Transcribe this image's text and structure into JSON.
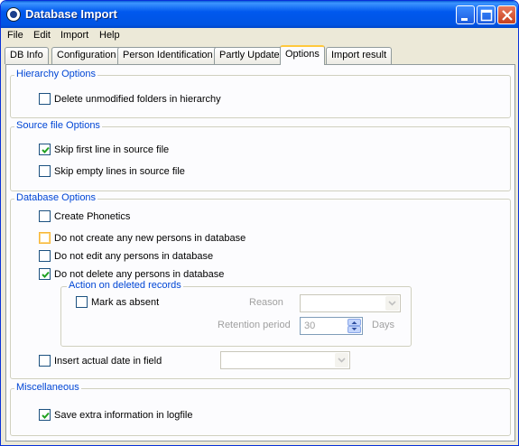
{
  "window": {
    "title": "Database Import"
  },
  "menu": [
    "File",
    "Edit",
    "Import",
    "Help"
  ],
  "tabs": [
    "DB Info",
    "Configuration",
    "Person Identification",
    "Partly Update",
    "Options",
    "Import result"
  ],
  "active_tab": "Options",
  "hierarchy": {
    "title": "Hierarchy Options",
    "delete_unmodified": {
      "label": "Delete unmodified folders in hierarchy",
      "checked": false
    }
  },
  "source": {
    "title": "Source file Options",
    "skip_first": {
      "label": "Skip first line in source file",
      "checked": true
    },
    "skip_empty": {
      "label": "Skip empty lines in source file",
      "checked": false
    }
  },
  "database": {
    "title": "Database Options",
    "create_phonetics": {
      "label": "Create Phonetics",
      "checked": false
    },
    "no_create": {
      "label": "Do not create any new persons in database",
      "checked": false
    },
    "no_edit": {
      "label": "Do not edit any persons in database",
      "checked": false
    },
    "no_delete": {
      "label": "Do not delete any persons in database",
      "checked": true
    },
    "action": {
      "title": "Action on deleted records",
      "mark_absent": {
        "label": "Mark as absent",
        "checked": false
      },
      "reason_label": "Reason",
      "retention_label": "Retention period",
      "retention_value": "30",
      "days_label": "Days"
    },
    "insert_date": {
      "label": "Insert actual date in field",
      "checked": false
    }
  },
  "misc": {
    "title": "Miscellaneous",
    "save_extra": {
      "label": "Save extra information in logfile",
      "checked": true
    }
  }
}
